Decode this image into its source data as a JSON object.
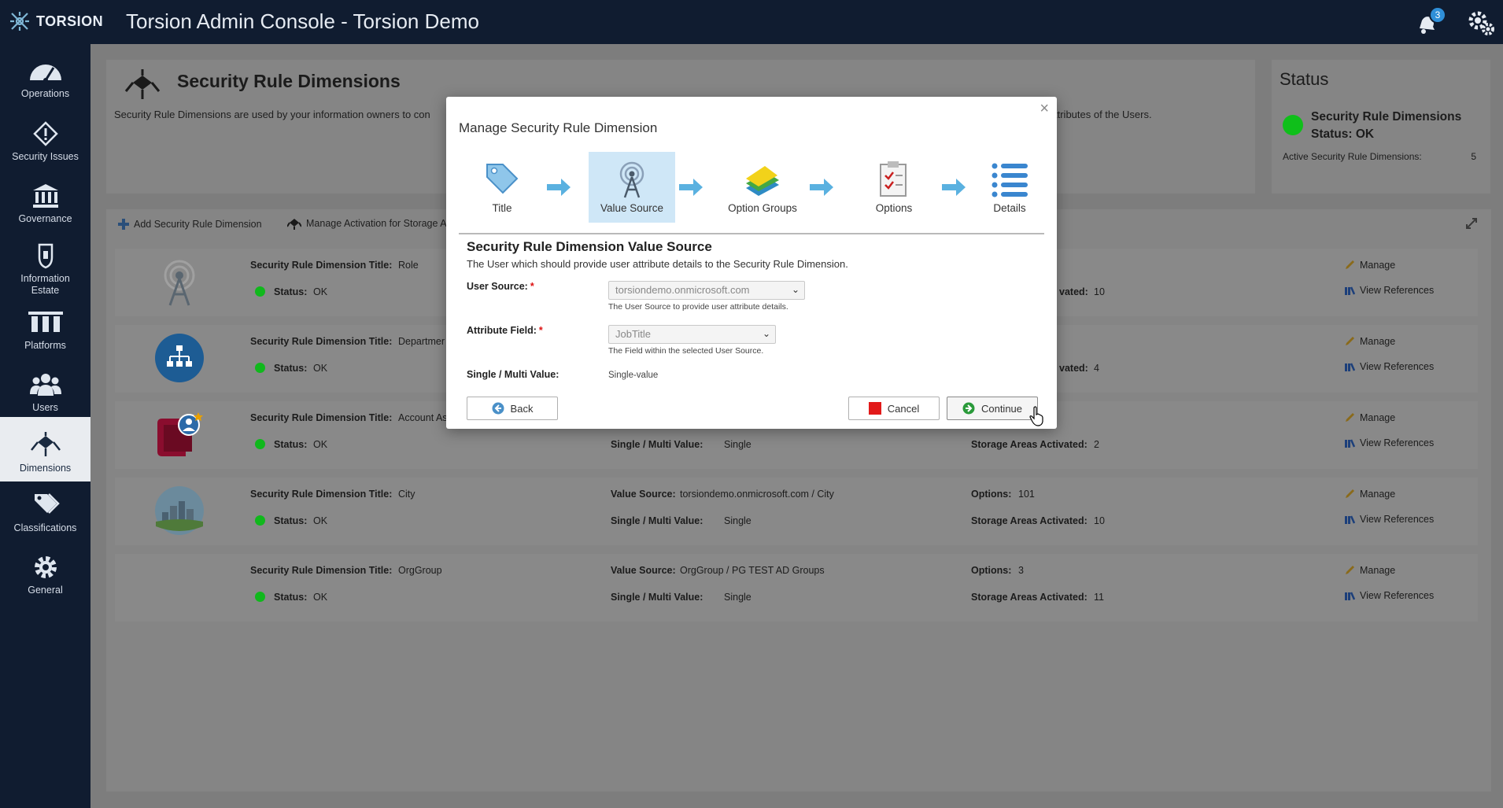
{
  "header": {
    "logo_text": "TORSION",
    "title": "Torsion Admin Console - Torsion Demo",
    "notifications_count": "3"
  },
  "sidebar": {
    "items": [
      {
        "label": "Operations",
        "icon": "gauge-icon"
      },
      {
        "label": "Security Issues",
        "icon": "alert-diamond-icon"
      },
      {
        "label": "Governance",
        "icon": "building-icon"
      },
      {
        "label": "Information Estate",
        "icon": "shield-icon"
      },
      {
        "label": "Platforms",
        "icon": "platforms-icon"
      },
      {
        "label": "Users",
        "icon": "users-icon"
      },
      {
        "label": "Dimensions",
        "icon": "dimensions-icon",
        "active": true
      },
      {
        "label": "Classifications",
        "icon": "tags-icon"
      },
      {
        "label": "General",
        "icon": "gear-icon"
      }
    ]
  },
  "page": {
    "title": "Security Rule Dimensions",
    "desc_left": "Security Rule Dimensions are used by your information owners to con",
    "desc_right": "ttributes of the Users."
  },
  "status": {
    "title": "Status",
    "line1": "Security Rule Dimensions",
    "line2": "Status: OK",
    "active_label": "Active Security Rule Dimensions:",
    "active_value": "5"
  },
  "toolbar": {
    "add_label": "Add Security Rule Dimension",
    "activation_label": "Manage Activation for Storage A"
  },
  "rows": [
    {
      "title_label": "Security Rule Dimension Title:",
      "title": "Role",
      "status_label": "Status:",
      "status": "OK",
      "partial_label": "vated:",
      "partial_value": "10",
      "manage": "Manage",
      "refs": "View References"
    },
    {
      "title_label": "Security Rule Dimension Title:",
      "title": "Departmer",
      "status_label": "Status:",
      "status": "OK",
      "partial_label": "vated:",
      "partial_value": "4",
      "manage": "Manage",
      "refs": "View References"
    },
    {
      "title_label": "Security Rule Dimension Title:",
      "title": "Account As",
      "status_label": "Status:",
      "status": "OK",
      "multi_label": "Single / Multi Value:",
      "multi_value": "Single",
      "areas_label": "Storage Areas Activated:",
      "areas_value": "2",
      "manage": "Manage",
      "refs": "View References"
    },
    {
      "title_label": "Security Rule Dimension Title:",
      "title": "City",
      "status_label": "Status:",
      "status": "OK",
      "source_label": "Value Source:",
      "source_value": "torsiondemo.onmicrosoft.com / City",
      "multi_label": "Single / Multi Value:",
      "multi_value": "Single",
      "options_label": "Options:",
      "options_value": "101",
      "areas_label": "Storage Areas Activated:",
      "areas_value": "10",
      "manage": "Manage",
      "refs": "View References"
    },
    {
      "title_label": "Security Rule Dimension Title:",
      "title": "OrgGroup",
      "status_label": "Status:",
      "status": "OK",
      "source_label": "Value Source:",
      "source_value": "OrgGroup / PG TEST AD Groups",
      "multi_label": "Single / Multi Value:",
      "multi_value": "Single",
      "options_label": "Options:",
      "options_value": "3",
      "areas_label": "Storage Areas Activated:",
      "areas_value": "11",
      "manage": "Manage",
      "refs": "View References"
    }
  ],
  "modal": {
    "close": "×",
    "title": "Manage Security Rule Dimension",
    "steps": [
      {
        "label": "Title",
        "icon": "tag-icon"
      },
      {
        "label": "Value Source",
        "icon": "antenna-icon",
        "active": true
      },
      {
        "label": "Option Groups",
        "icon": "option-groups-icon"
      },
      {
        "label": "Options",
        "icon": "checklist-icon"
      },
      {
        "label": "Details",
        "icon": "list-icon"
      }
    ],
    "section_title": "Security Rule Dimension Value Source",
    "section_desc": "The User which should provide user attribute details to the Security Rule Dimension.",
    "user_source_label": "User Source:",
    "user_source_value": "torsiondemo.onmicrosoft.com",
    "user_source_help": "The User Source to provide user attribute details.",
    "attribute_label": "Attribute Field:",
    "attribute_value": "JobTitle",
    "attribute_help": "The Field within the selected User Source.",
    "multi_label": "Single / Multi Value:",
    "multi_value": "Single-value",
    "required_mark": "*",
    "back_label": "Back",
    "cancel_label": "Cancel",
    "continue_label": "Continue"
  }
}
